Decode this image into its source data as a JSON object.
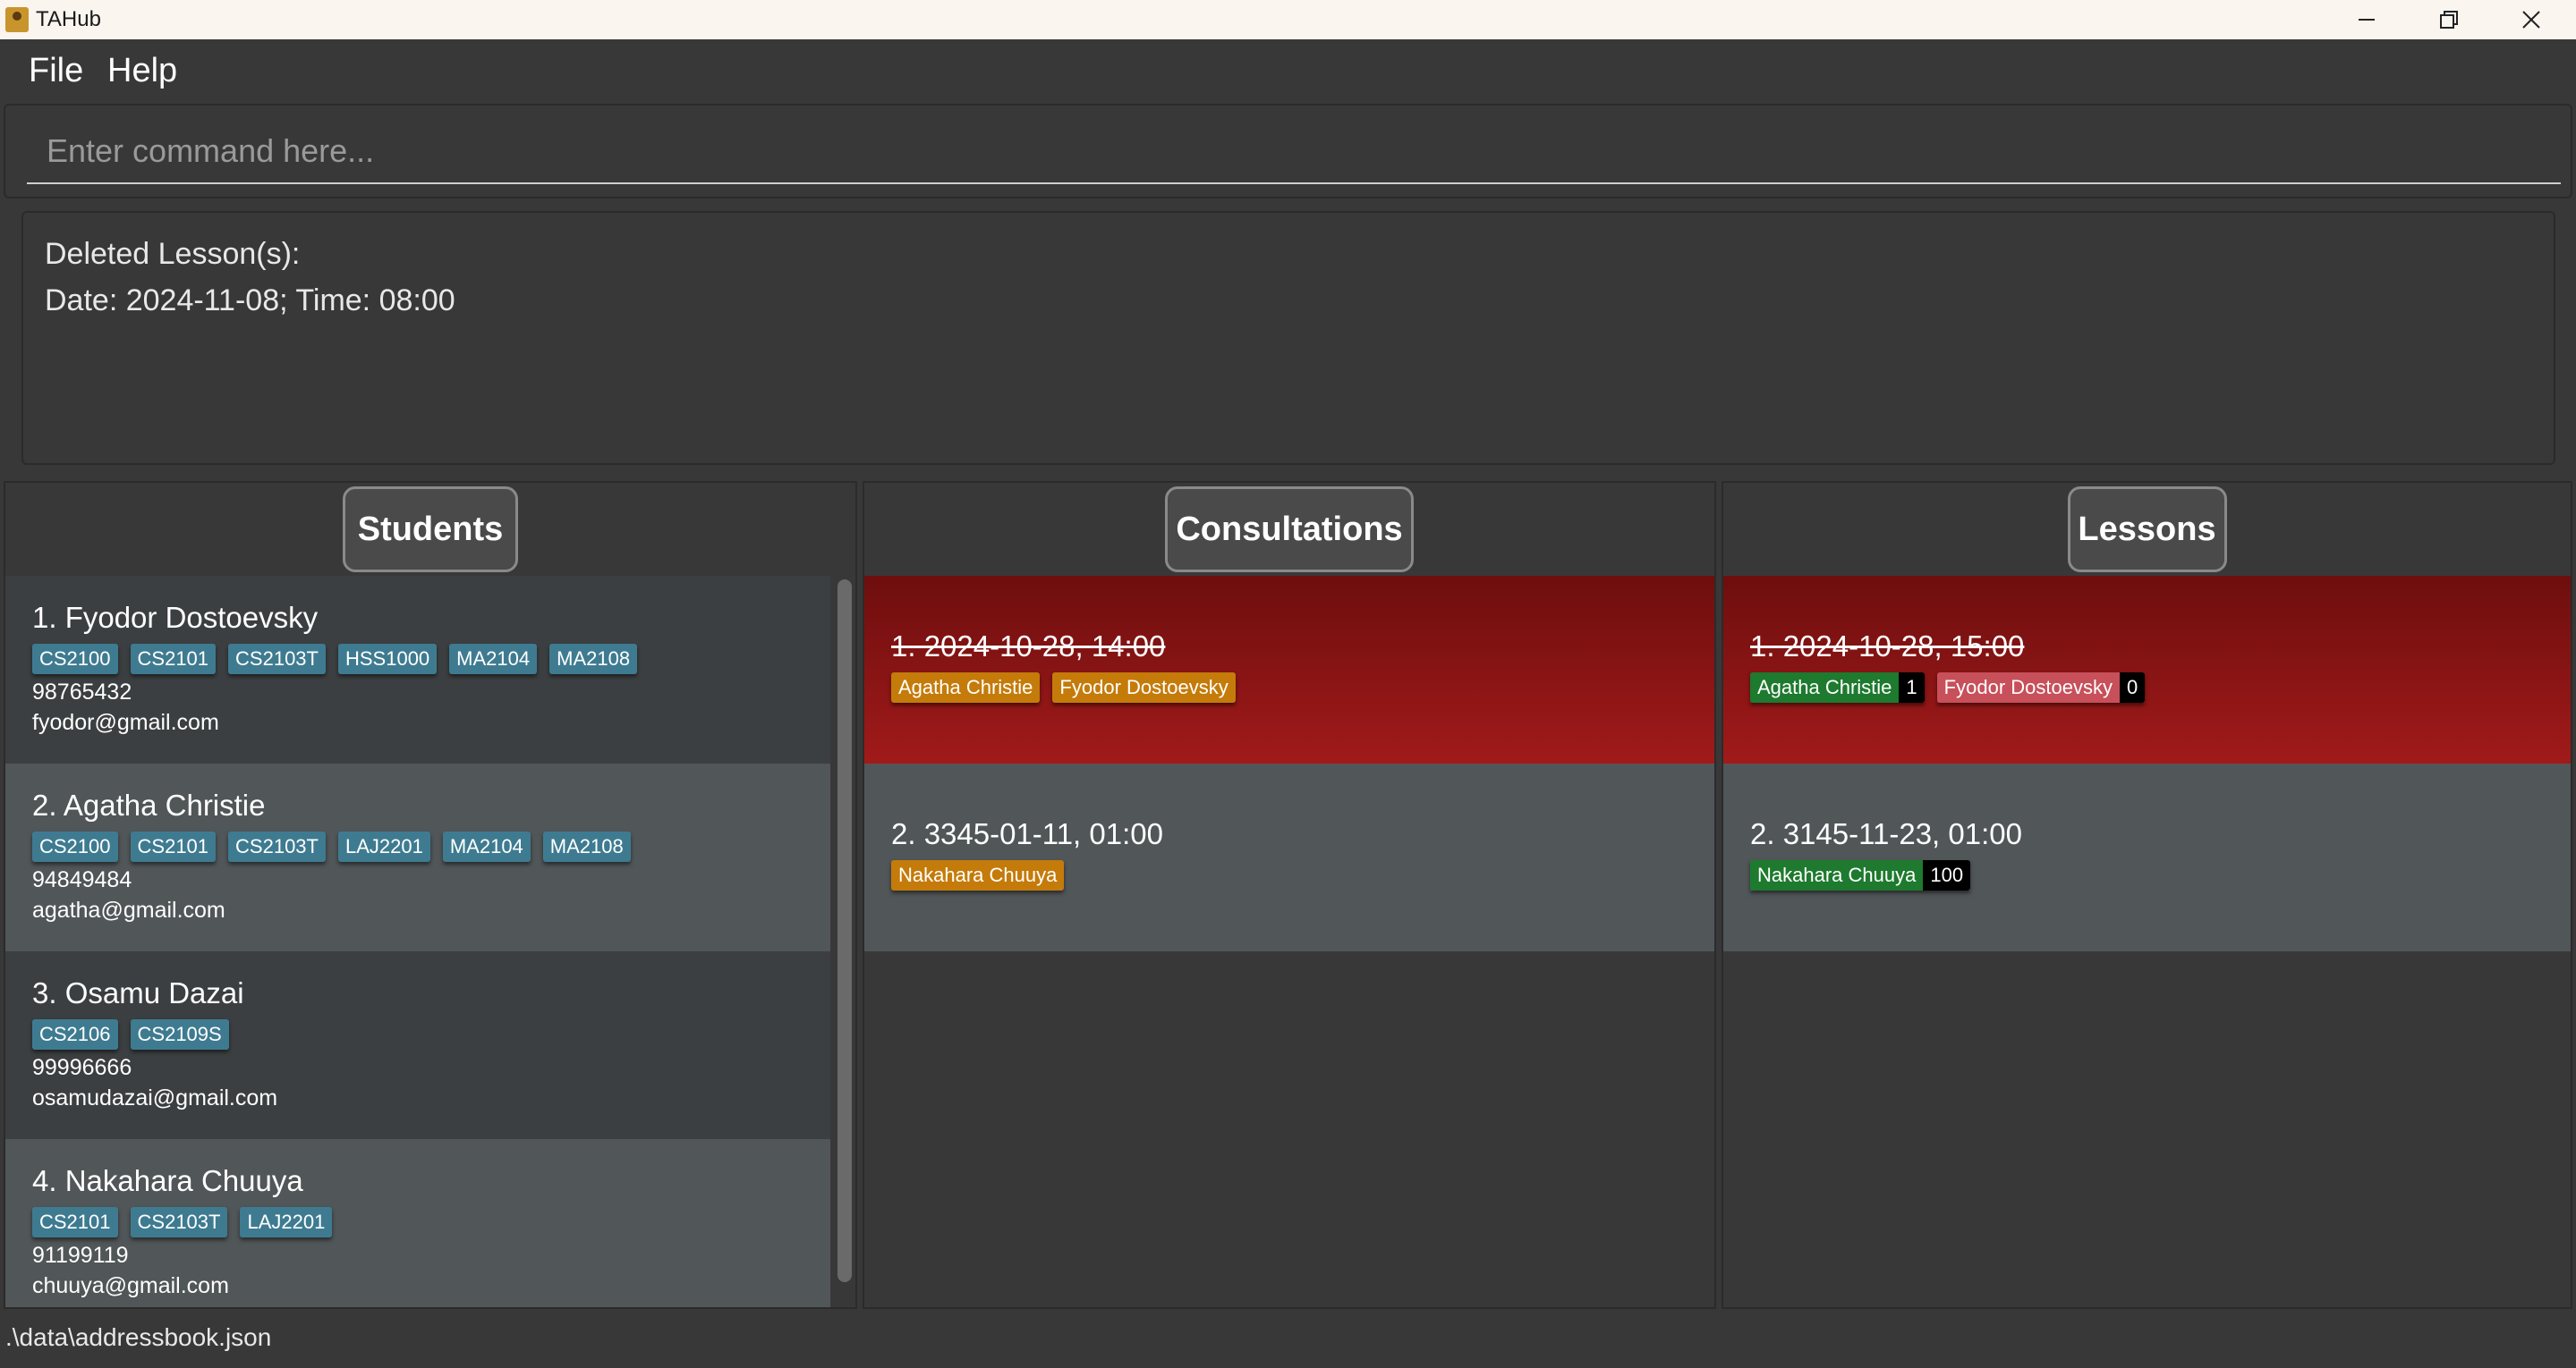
{
  "window": {
    "title": "TAHub"
  },
  "menu": {
    "file": "File",
    "help": "Help"
  },
  "command": {
    "placeholder": "Enter command here...",
    "value": ""
  },
  "result": {
    "line1": "Deleted Lesson(s):",
    "line2": "Date: 2024-11-08; Time: 08:00"
  },
  "students": {
    "header": "Students",
    "items": [
      {
        "name": "1. Fyodor Dostoevsky",
        "tags": [
          "CS2100",
          "CS2101",
          "CS2103T",
          "HSS1000",
          "MA2104",
          "MA2108"
        ],
        "phone": "98765432",
        "email": "fyodor@gmail.com"
      },
      {
        "name": "2. Agatha Christie",
        "tags": [
          "CS2100",
          "CS2101",
          "CS2103T",
          "LAJ2201",
          "MA2104",
          "MA2108"
        ],
        "phone": "94849484",
        "email": "agatha@gmail.com"
      },
      {
        "name": "3. Osamu Dazai",
        "tags": [
          "CS2106",
          "CS2109S"
        ],
        "phone": "99996666",
        "email": "osamudazai@gmail.com"
      },
      {
        "name": "4. Nakahara Chuuya",
        "tags": [
          "CS2101",
          "CS2103T",
          "LAJ2201"
        ],
        "phone": "91199119",
        "email": "chuuya@gmail.com"
      }
    ]
  },
  "consultations": {
    "header": "Consultations",
    "items": [
      {
        "title": "1. 2024-10-28, 14:00",
        "past": true,
        "students": [
          "Agatha Christie",
          "Fyodor Dostoevsky"
        ]
      },
      {
        "title": "2. 3345-01-11, 01:00",
        "past": false,
        "students": [
          "Nakahara Chuuya"
        ]
      }
    ]
  },
  "lessons": {
    "header": "Lessons",
    "items": [
      {
        "title": "1. 2024-10-28, 15:00",
        "past": true,
        "students": [
          {
            "name": "Agatha Christie",
            "count": "1",
            "status": "present"
          },
          {
            "name": "Fyodor Dostoevsky",
            "count": "0",
            "status": "absent"
          }
        ]
      },
      {
        "title": "2. 3145-11-23, 01:00",
        "past": false,
        "students": [
          {
            "name": "Nakahara Chuuya",
            "count": "100",
            "status": "present"
          }
        ]
      }
    ]
  },
  "status": {
    "path": ".\\data\\addressbook.json"
  },
  "colors": {
    "background": "#383838",
    "student_tag": "#3e7b91",
    "consult_tag": "#c57b0a",
    "lesson_present": "#1e7a2e",
    "lesson_absent": "#c7505a",
    "past_card": "#8f1414"
  }
}
